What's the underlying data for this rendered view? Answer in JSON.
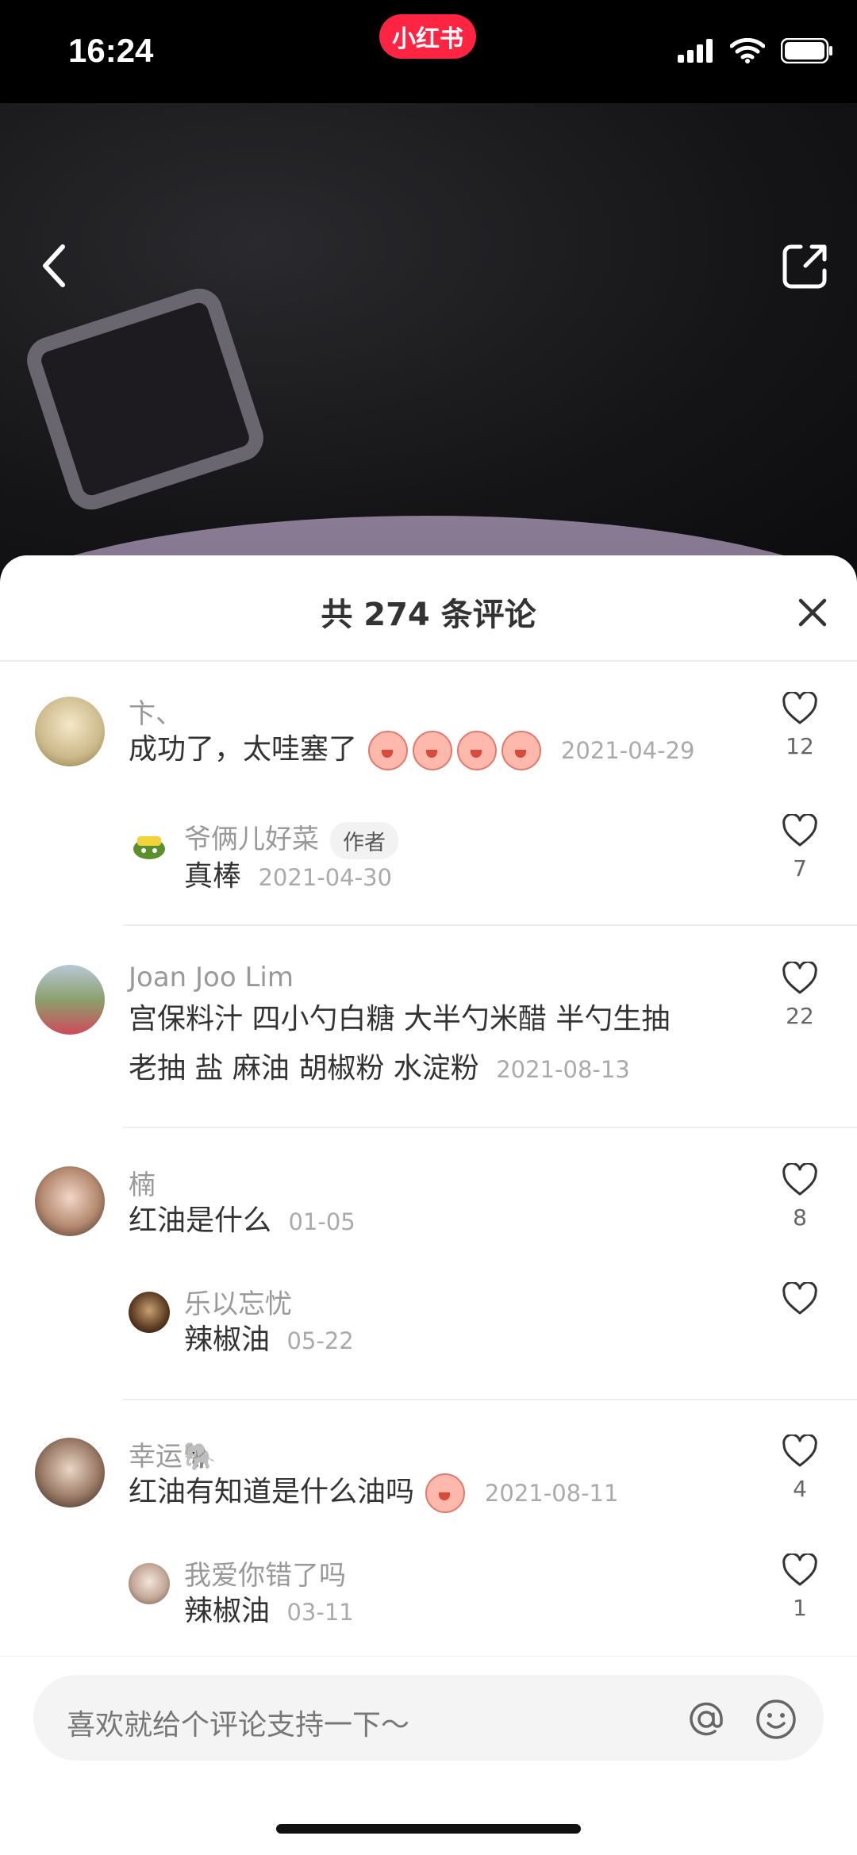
{
  "status_bar": {
    "time": "16:24",
    "app_badge": "小红书"
  },
  "sheet": {
    "title": "共 274 条评论"
  },
  "comments": [
    {
      "username": "卞、",
      "text": "成功了，太哇塞了",
      "emoji": "peach-face-emoji",
      "date": "2021-04-29",
      "likes": "12",
      "reply": {
        "username": "爷俩儿好菜",
        "author_tag": "作者",
        "text": "真棒",
        "date": "2021-04-30",
        "likes": "7"
      }
    },
    {
      "username": "Joan Joo Lim",
      "text_line1": "宫保料汁 四小勺白糖 大半勺米醋 半勺生抽",
      "text_line2": "老抽 盐 麻油 胡椒粉 水淀粉",
      "date": "2021-08-13",
      "likes": "22"
    },
    {
      "username": "楠",
      "text": "红油是什么",
      "date": "01-05",
      "likes": "8",
      "reply": {
        "username": "乐以忘忧",
        "text": "辣椒油",
        "date": "05-22",
        "likes": ""
      }
    },
    {
      "username": "幸运🐘",
      "text": "红油有知道是什么油吗",
      "emoji": "crying-laugh-emoji",
      "date": "2021-08-11",
      "likes": "4",
      "reply": {
        "username": "我爱你错了吗",
        "text": "辣椒油",
        "date": "03-11",
        "likes": "1"
      }
    }
  ],
  "input": {
    "placeholder": "喜欢就给个评论支持一下～"
  },
  "colors": {
    "brand": "#ff2442",
    "sheet_bg": "#ffffff",
    "muted_text": "#999999"
  }
}
